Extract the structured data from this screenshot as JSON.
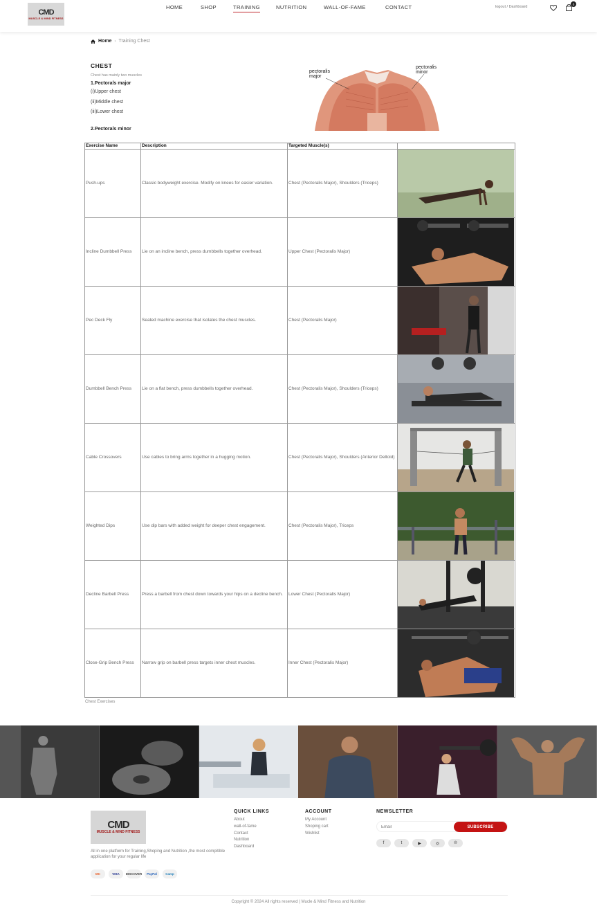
{
  "header": {
    "logo_text": "CMD",
    "logo_tagline": "MUSCLE & MIND FITNESS",
    "nav": [
      {
        "label": "HOME"
      },
      {
        "label": "SHOP"
      },
      {
        "label": "TRAINING",
        "active": true
      },
      {
        "label": "NUTRITION"
      },
      {
        "label": "WALL-OF-FAME"
      },
      {
        "label": "CONTACT"
      }
    ],
    "account_links": "logout / Dashboard",
    "cart_count": "0",
    "icons": [
      "heart-icon",
      "shopping-bag-icon",
      "home-icon"
    ]
  },
  "breadcrumb": {
    "home": "Home",
    "current": "Training Chest"
  },
  "intro": {
    "title": "CHEST",
    "subtitle": "Chest has mainly two muscles",
    "muscle1": "1.Pectorals major",
    "parts": [
      "(i)Upper chest",
      "(ii)Middle chest",
      "(iii)Lower chest"
    ],
    "muscle2": "2.Pectorals minor",
    "diagram_labels": {
      "left_line1": "pectoralis",
      "left_line2": "major",
      "right_line1": "pectoralis",
      "right_line2": "minor"
    }
  },
  "table": {
    "headers": [
      "Exercise Name",
      "Description",
      "Targeted Muscle(s)",
      ""
    ],
    "rows": [
      {
        "name": "Push-ups",
        "desc": "Classic bodyweight exercise. Modify on knees for easier variation.",
        "muscles": "Chest (Pectoralis Major), Shoulders (Triceps)"
      },
      {
        "name": "Incline Dumbbell Press",
        "desc": "Lie on an incline bench, press dumbbells together overhead.",
        "muscles": "Upper Chest (Pectoralis Major)"
      },
      {
        "name": "Pec Deck Fly",
        "desc": "Seated machine exercise that isolates the chest muscles.",
        "muscles": "Chest (Pectoralis Major)"
      },
      {
        "name": "Dumbbell Bench Press",
        "desc": "Lie on a flat bench, press dumbbells together overhead.",
        "muscles": "Chest (Pectoralis Major), Shoulders (Triceps)"
      },
      {
        "name": "Cable Crossovers",
        "desc": "Use cables to bring arms together in a hugging motion.",
        "muscles": "Chest (Pectoralis Major), Shoulders (Anterior Deltoid)"
      },
      {
        "name": "Weighted Dips",
        "desc": "Use dip bars with added weight for deeper chest engagement.",
        "muscles": "Chest (Pectoralis Major), Triceps"
      },
      {
        "name": "Decline Barbell Press",
        "desc": "Press a barbell from chest down towards your hips on a decline bench.",
        "muscles": "Lower Chest (Pectoralis Major)"
      },
      {
        "name": "Close-Grip Bench Press",
        "desc": "Narrow grip on barbell press targets inner chest muscles.",
        "muscles": "Inner Chest (Pectoralis Major)"
      }
    ],
    "caption": "Chest Exercises"
  },
  "footer": {
    "logo_text": "CMD",
    "logo_tagline": "MUSCLE & MIND FITNESS",
    "description": "All in one platform for Training,Shoping and Nutrition ,the most compitible application for your regular life",
    "payments": [
      "MC",
      "VISA",
      "DISCOVER",
      "PayPal",
      "Camp"
    ],
    "quick_links_title": "QUICK LINKS",
    "quick_links": [
      "About",
      "wall-of-fame",
      "Contact",
      "Nutrition",
      "Dashboard"
    ],
    "account_title": "ACCOUNT",
    "account_links": [
      "My Account",
      "Shoping cart",
      "Wishlist"
    ],
    "newsletter_title": "NEWSLETTER",
    "email_placeholder": "Email",
    "subscribe_label": "SUBSCRIBE",
    "social": [
      "f",
      "t",
      "▶",
      "◎",
      "℗"
    ],
    "copyright": "Copyright © 2024 All rights reserved | Mucle & Mind Fitness and Nutrition"
  }
}
